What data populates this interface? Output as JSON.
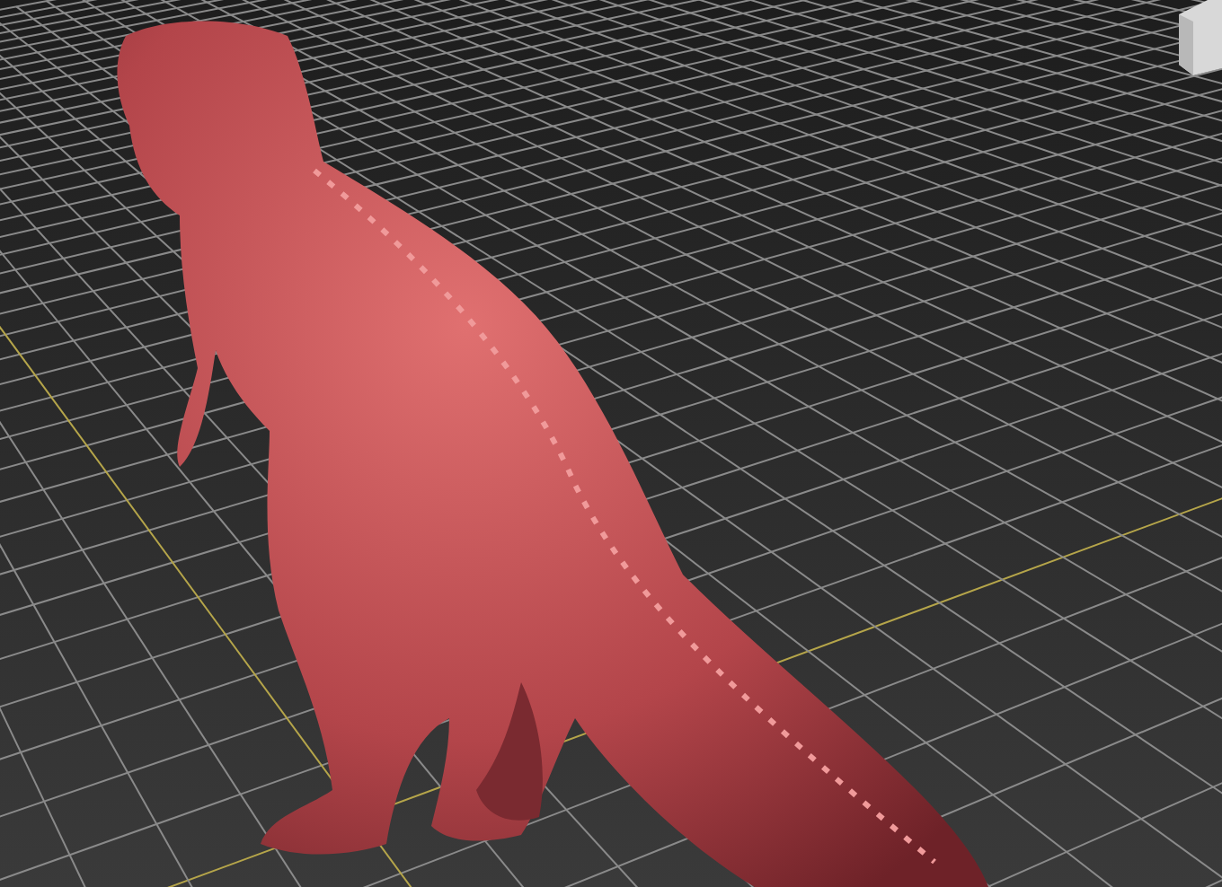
{
  "viewport": {
    "grid_visible": true,
    "view_cube_visible": true
  }
}
